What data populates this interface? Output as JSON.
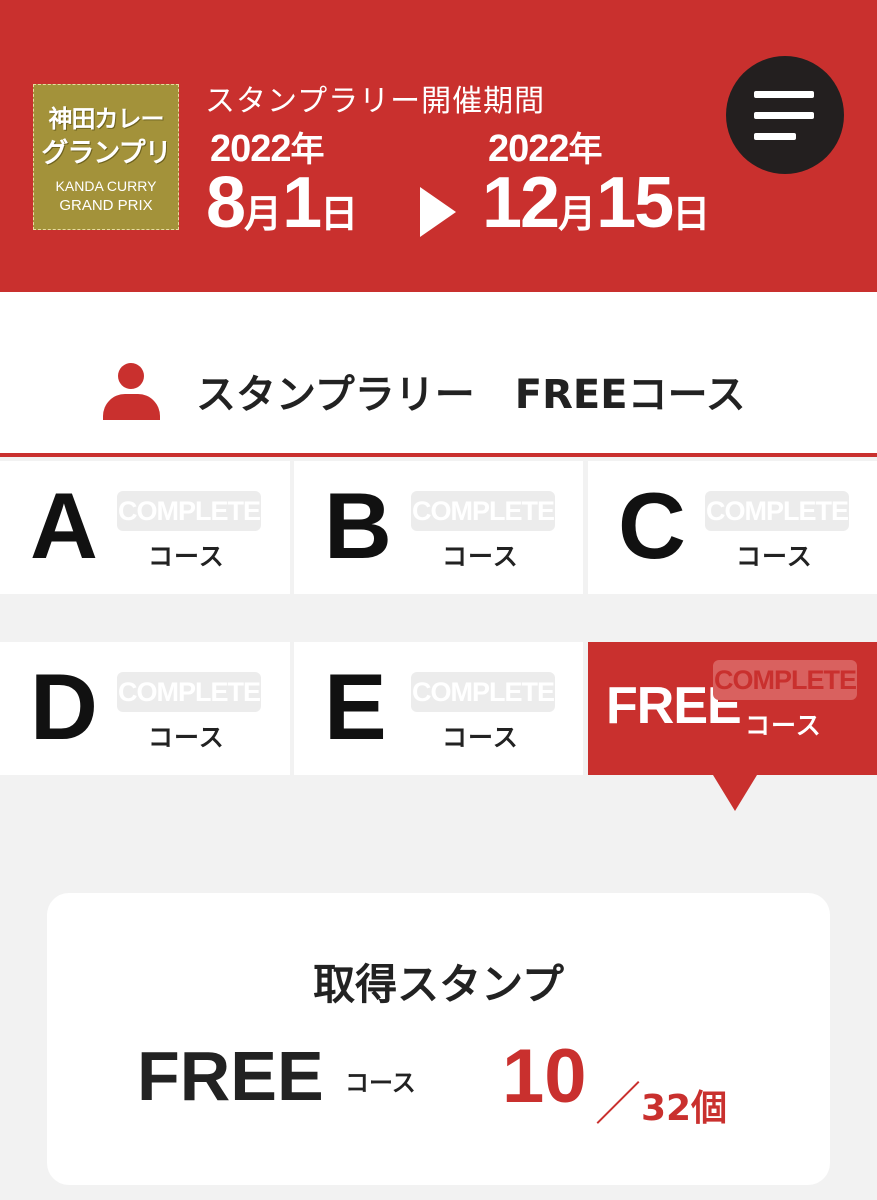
{
  "header": {
    "logo": {
      "line1": "神田カレー",
      "line2": "グランプリ",
      "line3": "KANDA CURRY",
      "line4": "GRAND PRIX"
    },
    "period_label": "スタンプラリー開催期間",
    "start": {
      "year": "2022",
      "year_unit": "年",
      "month": "8",
      "month_unit": "月",
      "day": "1",
      "day_unit": "日"
    },
    "end": {
      "year": "2022",
      "year_unit": "年",
      "month": "12",
      "month_unit": "月",
      "day": "15",
      "day_unit": "日"
    },
    "menu_icon": "hamburger-menu-icon"
  },
  "course_title": {
    "icon": "user-icon",
    "label": "スタンプラリー　FREEコース"
  },
  "courses": [
    {
      "letter": "A",
      "badge": "COMPLETE",
      "label": "コース",
      "active": false
    },
    {
      "letter": "B",
      "badge": "COMPLETE",
      "label": "コース",
      "active": false
    },
    {
      "letter": "C",
      "badge": "COMPLETE",
      "label": "コース",
      "active": false
    },
    {
      "letter": "D",
      "badge": "COMPLETE",
      "label": "コース",
      "active": false
    },
    {
      "letter": "E",
      "badge": "COMPLETE",
      "label": "コース",
      "active": false
    },
    {
      "letter": "FREE",
      "badge": "COMPLETE",
      "label": "コース",
      "active": true
    }
  ],
  "stamp_card": {
    "title": "取得スタンプ",
    "course": "FREE",
    "course_sub": "コース",
    "count": "10",
    "separator": "／",
    "total": "32",
    "unit": "個"
  },
  "colors": {
    "brand_red": "#c9302e",
    "logo_gold": "#a3923a",
    "menu_dark": "#231f1f"
  }
}
